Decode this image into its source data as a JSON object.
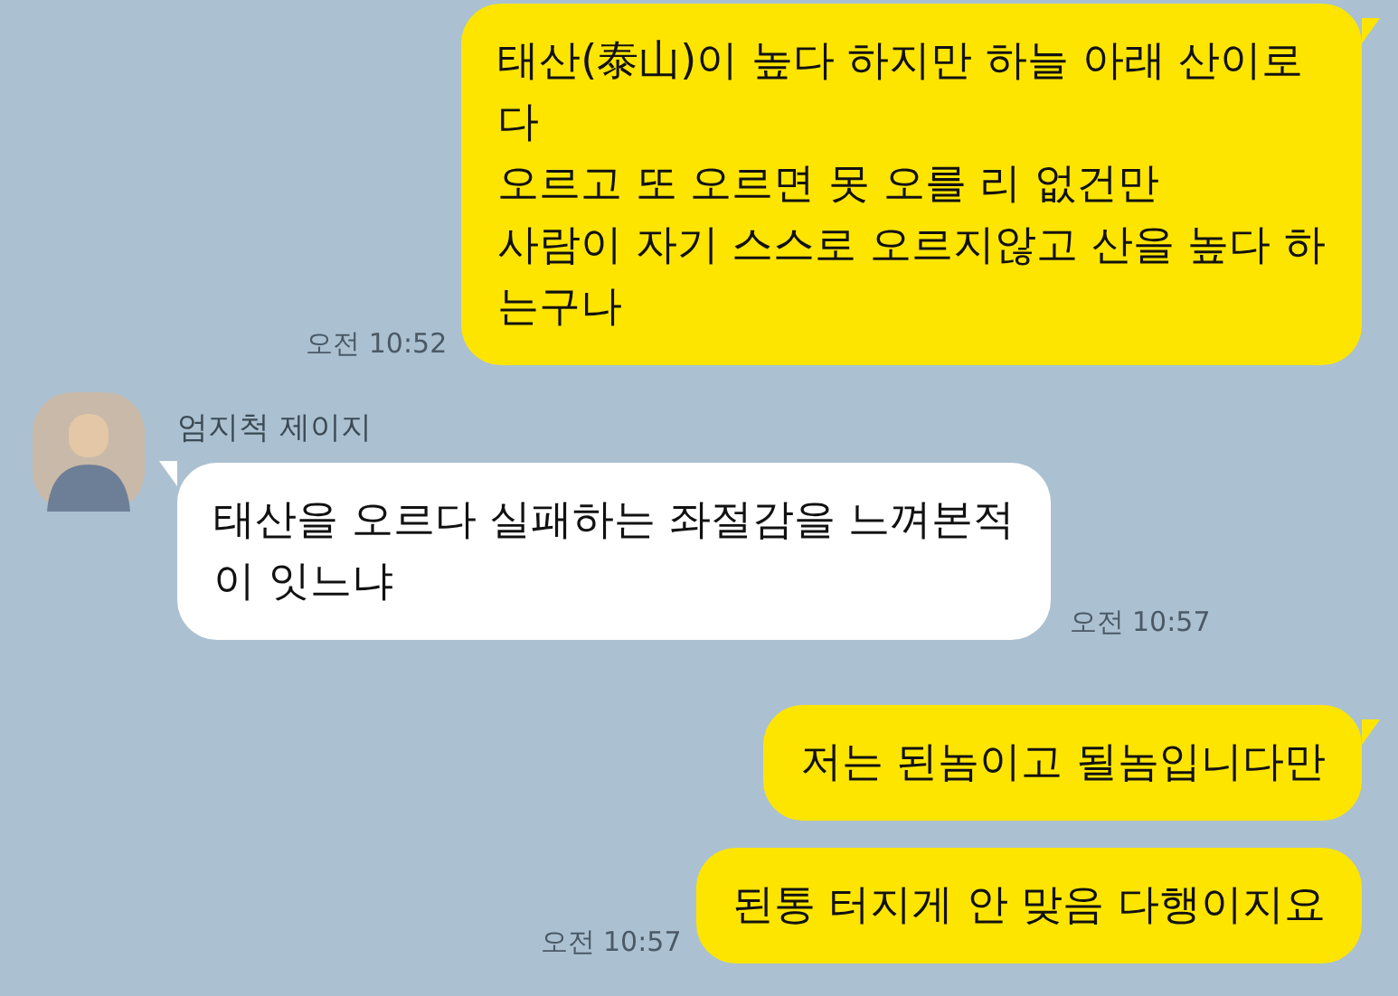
{
  "messages": [
    {
      "kind": "sent",
      "text": "태산(泰山)이 높다 하지만 하늘 아래 산이로\n다\n오르고 또 오르면 못 오를 리 없건만\n사람이 자기 스스로 오르지않고 산을 높다 하\n는구나",
      "time": "오전 10:52",
      "tail": true
    },
    {
      "kind": "received",
      "name": "엄지척 제이지",
      "text": "태산을 오르다 실패하는 좌절감을 느껴본적\n이 잇느냐",
      "time": "오전 10:57",
      "tail": true
    },
    {
      "kind": "sent",
      "text": "저는 된놈이고 될놈입니다만",
      "tail": true
    },
    {
      "kind": "sent",
      "text": "된통 터지게 안 맞음 다행이지요",
      "time": "오전 10:57",
      "tail": false
    }
  ]
}
